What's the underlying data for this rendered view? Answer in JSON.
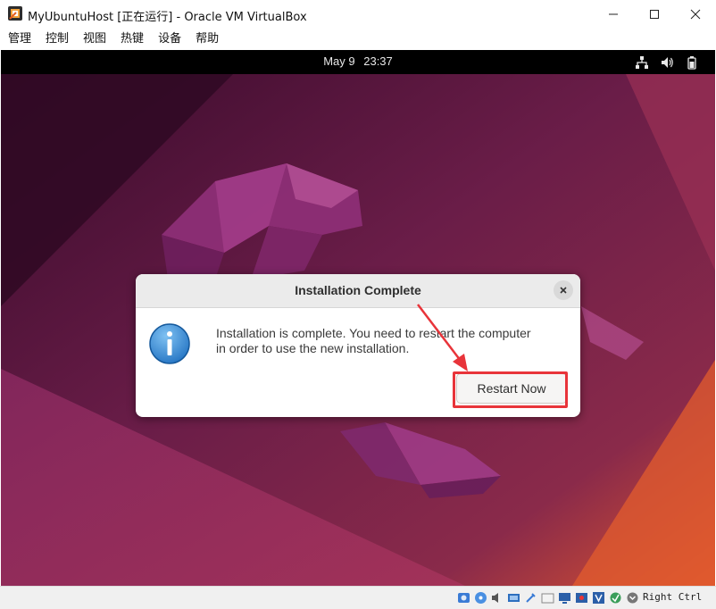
{
  "window": {
    "title": "MyUbuntuHost [正在运行] - Oracle VM VirtualBox",
    "minimize_icon": "minimize-icon",
    "maximize_icon": "maximize-icon",
    "close_icon": "close-icon"
  },
  "menubar": {
    "items": [
      "管理",
      "控制",
      "视图",
      "热键",
      "设备",
      "帮助"
    ]
  },
  "guest_topbar": {
    "date": "May 9",
    "time": "23:37",
    "icons": [
      "network-icon",
      "volume-icon",
      "battery-icon"
    ]
  },
  "dialog": {
    "title": "Installation Complete",
    "message_line1": "Installation is complete. You need to restart the computer",
    "message_line2": "in order to use the new installation.",
    "button_label": "Restart Now",
    "icon": "info-icon"
  },
  "annotation": {
    "color": "#e8343a"
  },
  "statusbar": {
    "host_key": "Right Ctrl",
    "icons": [
      "hard-disk-icon",
      "optical-drive-icon",
      "audio-icon",
      "network-adapter-icon",
      "usb-icon",
      "shared-folders-icon",
      "display-icon",
      "recording-icon",
      "cpu-icon",
      "mouse-integration-icon",
      "arrow-down-icon"
    ]
  },
  "colors": {
    "wallpaper_dark": "#2c0a22",
    "wallpaper_mid": "#6d1f4a",
    "wallpaper_orange": "#e0582e"
  }
}
